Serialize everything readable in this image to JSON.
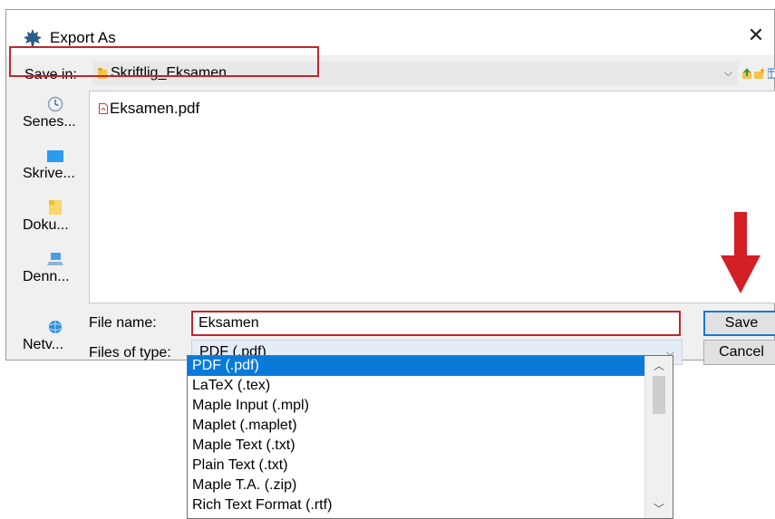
{
  "window": {
    "title": "Export As",
    "close_glyph": "✕",
    "app_icon": "maple-leaf-icon"
  },
  "save_in": {
    "label": "Save in:",
    "value": "Skriftlig_Eksamen",
    "folder_icon": "folder-icon",
    "dropdown_glyph": "⌵"
  },
  "toolbar": {
    "icons": [
      "up-folder-icon",
      "new-folder-icon",
      "view-menu-icon"
    ]
  },
  "places": [
    {
      "label": "Senes...",
      "icon": "recent-icon"
    },
    {
      "label": "Skrive...",
      "icon": "desktop-icon"
    },
    {
      "label": "Doku...",
      "icon": "documents-icon"
    },
    {
      "label": "Denn...",
      "icon": "this-pc-icon"
    },
    {
      "label": "Netv...",
      "icon": "network-icon"
    }
  ],
  "files": [
    {
      "name": "Eksamen.pdf",
      "icon": "pdf-file-icon"
    }
  ],
  "file_name": {
    "label": "File name:",
    "value": "Eksamen"
  },
  "file_type": {
    "label": "Files of type:",
    "value": "PDF (.pdf)",
    "dropdown_glyph": "⌵",
    "options": [
      "PDF (.pdf)",
      "LaTeX (.tex)",
      "Maple Input (.mpl)",
      "Maplet (.maplet)",
      "Maple Text (.txt)",
      "Plain Text (.txt)",
      "Maple T.A. (.zip)",
      "Rich Text Format (.rtf)"
    ],
    "selected_index": 0
  },
  "buttons": {
    "save": "Save",
    "cancel": "Cancel"
  },
  "colors": {
    "highlight_red": "#c0262d",
    "selection_blue": "#0a7ad8",
    "annotation_arrow": "#d31f26"
  }
}
